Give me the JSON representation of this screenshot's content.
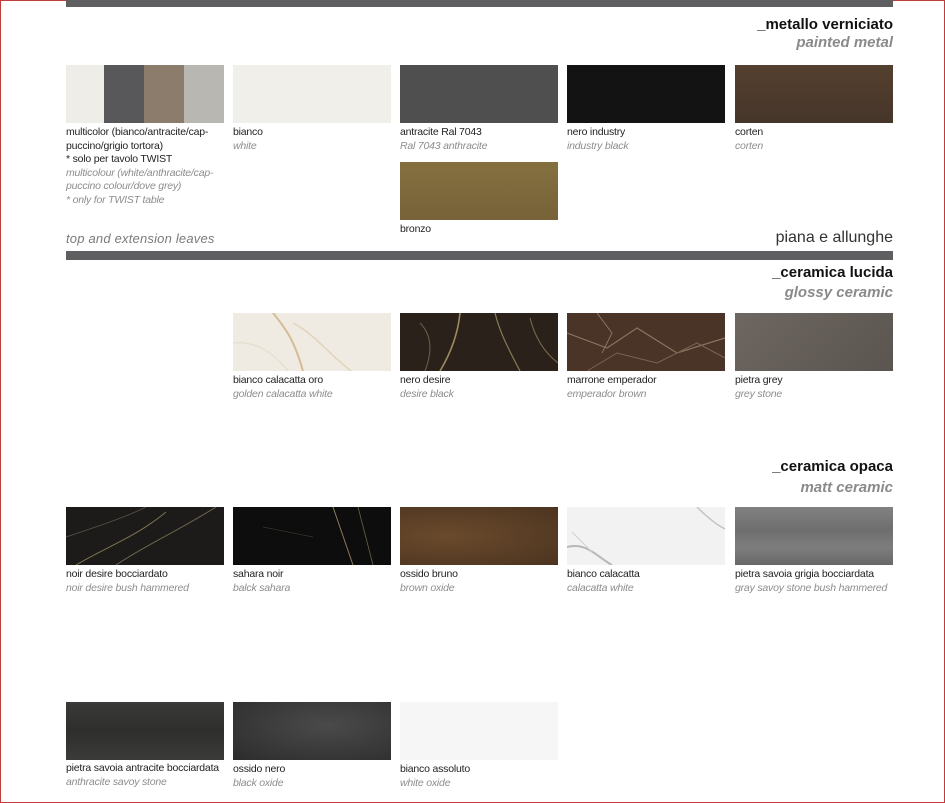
{
  "painted_metal": {
    "title": "_metallo verniciato",
    "subtitle": "painted metal",
    "items": [
      {
        "name": "multicolor (bianco/antracite/cap-puccino/grigio tortora)",
        "note": "* solo per tavolo TWIST",
        "en": "multicolour (white/anthracite/cap-puccino colour/dove grey)",
        "en_note": "* only for TWIST table"
      },
      {
        "name": "bianco",
        "en": "white",
        "color": "#f0efea"
      },
      {
        "name": "antracite Ral 7043",
        "en": "Ral 7043 anthracite",
        "color": "#4f4f50"
      },
      {
        "name": "nero industry",
        "en": "industry black",
        "color": "#141313"
      },
      {
        "name": "corten",
        "en": "corten",
        "color": "#4d3b2c"
      },
      {
        "name": "bronzo",
        "en": "",
        "color": "#7e6a3f"
      }
    ],
    "multicolor_colors": [
      "#eeede8",
      "#58575a",
      "#8c7c6c",
      "#b9b7b2"
    ]
  },
  "leaves": {
    "en": "top and extension leaves",
    "it": "piana e allunghe"
  },
  "glossy_ceramic": {
    "title": "_ceramica lucida",
    "subtitle": "glossy ceramic",
    "items": [
      {
        "name": "bianco calacatta oro",
        "en": "golden calacatta white"
      },
      {
        "name": "nero desire",
        "en": "desire black"
      },
      {
        "name": "marrone emperador",
        "en": "emperador brown"
      },
      {
        "name": "pietra grey",
        "en": "grey stone"
      }
    ]
  },
  "matt_ceramic": {
    "title": "_ceramica opaca",
    "subtitle": "matt ceramic",
    "items": [
      {
        "name": "noir desire bocciardato",
        "en": "noir desire bush hammered"
      },
      {
        "name": "sahara noir",
        "en": "balck sahara"
      },
      {
        "name": "ossido bruno",
        "en": "brown oxide"
      },
      {
        "name": "bianco calacatta",
        "en": "calacatta white"
      },
      {
        "name": "pietra savoia grigia bocciardata",
        "en": "gray savoy stone bush hammered"
      },
      {
        "name": "pietra savoia antracite bocciardata",
        "en": "anthracite savoy stone"
      },
      {
        "name": "ossido nero",
        "en": "black oxide"
      },
      {
        "name": "bianco assoluto",
        "en": "white oxide"
      }
    ]
  }
}
